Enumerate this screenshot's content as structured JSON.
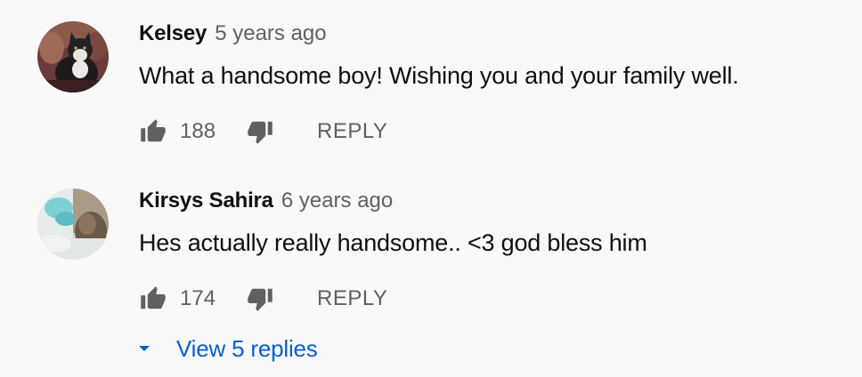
{
  "comments": [
    {
      "author": "Kelsey",
      "timestamp": "5 years ago",
      "text": "What a handsome boy! Wishing you and your family well.",
      "likes": "188",
      "reply_label": "REPLY",
      "avatar_icon": "cat-photo-avatar"
    },
    {
      "author": "Kirsys Sahira",
      "timestamp": "6 years ago",
      "text": "Hes actually really handsome.. <3 god bless him",
      "likes": "174",
      "reply_label": "REPLY",
      "avatar_icon": "photo-avatar",
      "view_replies_label": "View 5 replies"
    }
  ],
  "colors": {
    "background": "#f9f9f9",
    "text_primary": "#0f0f0f",
    "text_secondary": "#606060",
    "link_blue": "#065fd4",
    "icon_gray": "#606060"
  }
}
